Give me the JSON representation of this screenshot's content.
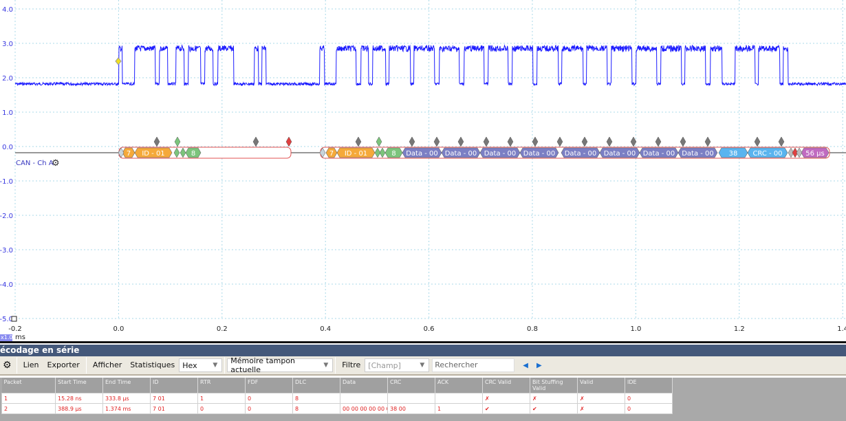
{
  "scope": {
    "y_ticks": [
      "4.0",
      "3.0",
      "2.0",
      "1.0",
      "0.0",
      "-1.0",
      "-2.0",
      "-3.0",
      "-4.0",
      "-5.0"
    ],
    "x_ticks": [
      "-0.2",
      "0.0",
      "0.2",
      "0.4",
      "0.6",
      "0.8",
      "1.0",
      "1.2",
      "1.4"
    ],
    "x_unit": "ms",
    "zoom_tag": "x1.0",
    "channel_label": "CAN - Ch A",
    "trace_color": "#1a1aff",
    "bus_segments": {
      "frame1": [
        {
          "label": "7",
          "color": "#f5a93a"
        },
        {
          "label": "ID - 01",
          "color": "#f5a93a"
        },
        {
          "label": "8",
          "color": "#7cc47c"
        }
      ],
      "frame2": [
        {
          "label": "7",
          "color": "#f5a93a"
        },
        {
          "label": "ID - 01",
          "color": "#f5a93a"
        },
        {
          "label": "8",
          "color": "#7cc47c"
        },
        {
          "label": "Data - 00",
          "color": "#7b7fc4"
        },
        {
          "label": "Data - 00",
          "color": "#7b7fc4"
        },
        {
          "label": "Data - 00",
          "color": "#7b7fc4"
        },
        {
          "label": "Data - 00",
          "color": "#7b7fc4"
        },
        {
          "label": "Data - 00",
          "color": "#7b7fc4"
        },
        {
          "label": "Data - 00",
          "color": "#7b7fc4"
        },
        {
          "label": "Data - 00",
          "color": "#7b7fc4"
        },
        {
          "label": "Data - 00",
          "color": "#7b7fc4"
        },
        {
          "label": "38",
          "color": "#5ab4ef"
        },
        {
          "label": "CRC - 00",
          "color": "#5ab4ef"
        },
        {
          "label": "56 µs",
          "color": "#c06ac0"
        }
      ]
    }
  },
  "panel": {
    "title": "écodage en série",
    "toolbar": {
      "link": "Lien",
      "export": "Exporter",
      "display": "Afficher",
      "stats": "Statistiques",
      "format": "Hex",
      "buffer": "Mémoire tampon actuelle",
      "filter": "Filtre",
      "field_placeholder": "[Champ]",
      "search_placeholder": "Rechercher"
    },
    "columns": [
      "Packet",
      "Start Time",
      "End Time",
      "ID",
      "RTR",
      "FDF",
      "DLC",
      "Data",
      "CRC",
      "ACK",
      "CRC Valid",
      "Bit Stuffing Valid",
      "Valid",
      "IDE"
    ],
    "rows": [
      [
        "1",
        "15.28 ns",
        "333.8 µs",
        "7 01",
        "1",
        "0",
        "8",
        "",
        "",
        "",
        "✗",
        "✗",
        "✗",
        "0"
      ],
      [
        "2",
        "388.9 µs",
        "1.374 ms",
        "7 01",
        "0",
        "0",
        "8",
        "00 00 00 00 00 0...",
        "38 00",
        "1",
        "✔",
        "✔",
        "✗",
        "0"
      ]
    ]
  }
}
